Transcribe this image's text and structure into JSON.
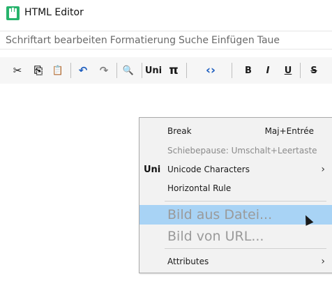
{
  "window": {
    "title": "HTML Editor"
  },
  "menu": {
    "items": [
      "Schriftart bearbeiten",
      "Formatierung",
      "Suche",
      "Einfügen",
      "Taue"
    ]
  },
  "toolbar": {
    "buttons": [
      {
        "name": "cut-icon",
        "glyph": "✂"
      },
      {
        "name": "copy-icon",
        "glyph": "⎘"
      },
      {
        "name": "paste-icon",
        "glyph": "📋"
      },
      {
        "name": "undo-icon",
        "glyph": "↶"
      },
      {
        "name": "redo-icon",
        "glyph": "↷"
      },
      {
        "name": "search-icon",
        "glyph": "🔍"
      },
      {
        "name": "unicode-icon",
        "glyph": "Uni"
      },
      {
        "name": "pi-icon",
        "glyph": "π"
      },
      {
        "name": "code-icon",
        "glyph": "‹›"
      },
      {
        "name": "bold-icon",
        "glyph": "B"
      },
      {
        "name": "italic-icon",
        "glyph": "I"
      },
      {
        "name": "underline-icon",
        "glyph": "U"
      },
      {
        "name": "strikethrough-icon",
        "glyph": "S"
      }
    ]
  },
  "context_menu": {
    "break_label": "Break",
    "break_shortcut": "Maj+Entrée",
    "nbsp_label": "Schiebepause: Umschalt+Leertaste",
    "unicode_icon": "Uni",
    "unicode_label": "Unicode Characters",
    "hr_label": "Horizontal Rule",
    "image_file_label": "Bild aus Datei...",
    "image_url_label": "Bild von URL...",
    "attributes_label": "Attributes",
    "submenu_arrow": "›"
  },
  "colors": {
    "highlight": "#a8d3f5",
    "app_icon": "#27b36c"
  }
}
